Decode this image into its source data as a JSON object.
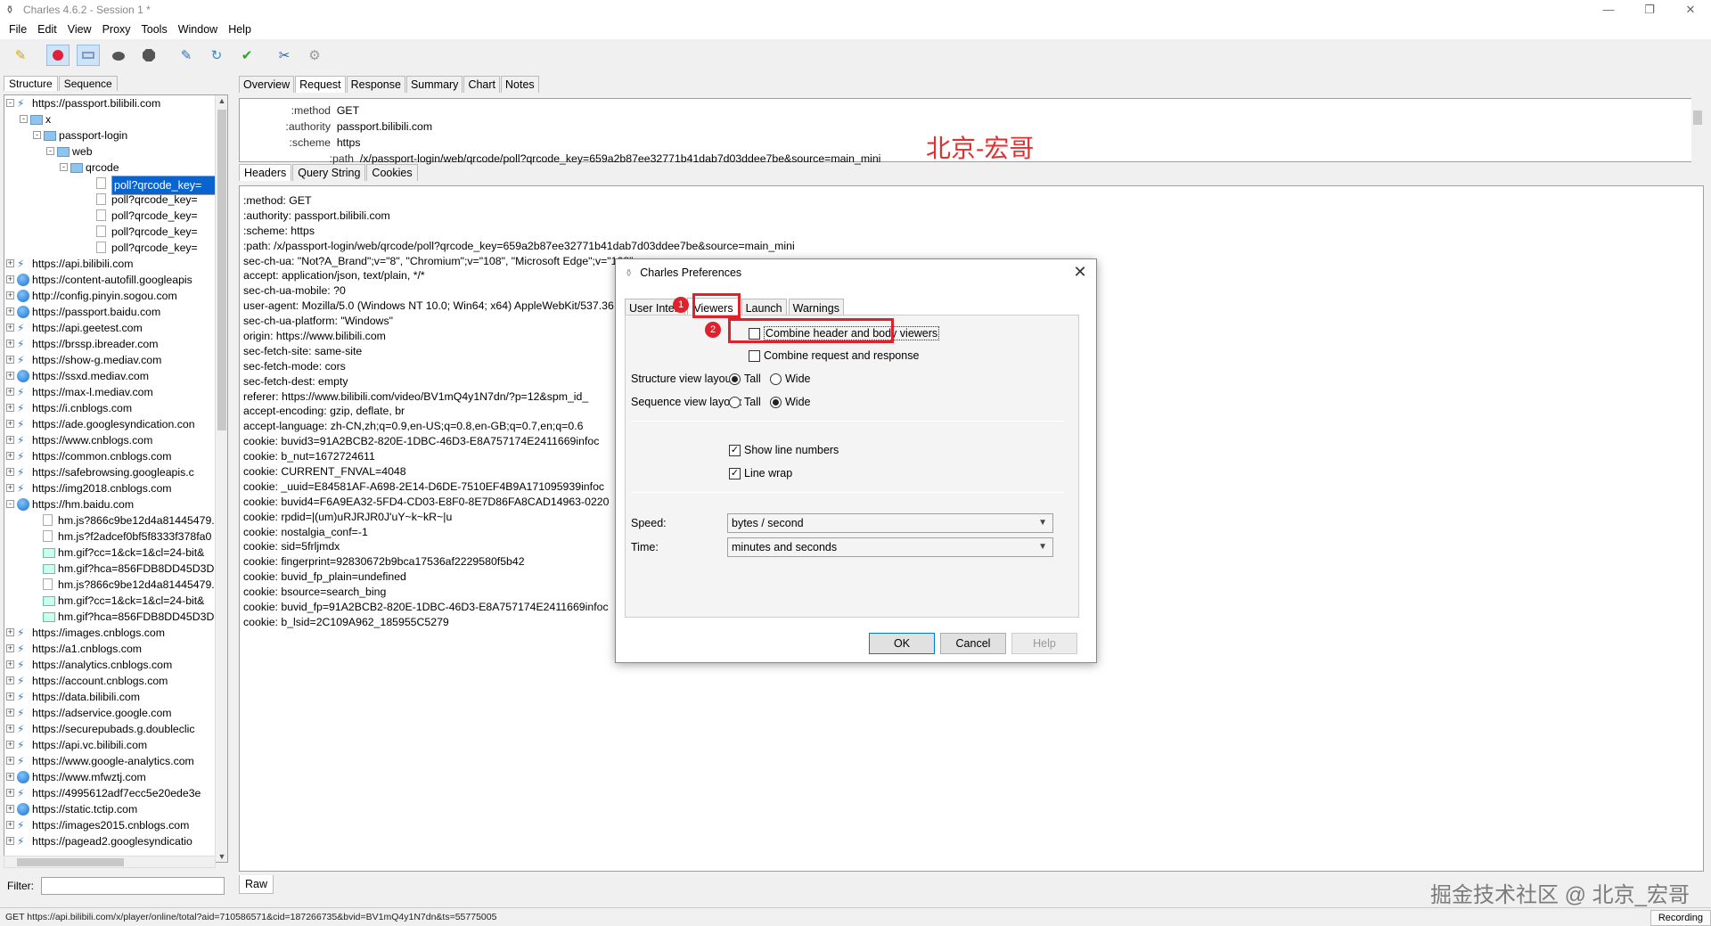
{
  "window": {
    "title": "Charles 4.6.2 - Session 1 *"
  },
  "menu": [
    "File",
    "Edit",
    "View",
    "Proxy",
    "Tools",
    "Window",
    "Help"
  ],
  "toolbar": {
    "icons": [
      "broom-icon",
      "record-icon",
      "throttle-icon",
      "turtle-icon",
      "breakpoint-icon",
      "compose-icon",
      "repeat-icon",
      "validate-icon",
      "tools-icon",
      "settings-icon"
    ]
  },
  "left": {
    "tabs": [
      "Structure",
      "Sequence"
    ],
    "tree": [
      {
        "label": "https://passport.bilibili.com",
        "indent": 0,
        "icon": "lock",
        "exp": "-"
      },
      {
        "label": "x",
        "indent": 1,
        "icon": "folder",
        "exp": "-"
      },
      {
        "label": "passport-login",
        "indent": 2,
        "icon": "folder",
        "exp": "-"
      },
      {
        "label": "web",
        "indent": 3,
        "icon": "folder",
        "exp": "-"
      },
      {
        "label": "qrcode",
        "indent": 4,
        "icon": "folder",
        "exp": "-"
      },
      {
        "label": "poll?qrcode_key=",
        "indent": 5,
        "icon": "doc",
        "exp": "",
        "selected": true
      },
      {
        "label": "poll?qrcode_key=",
        "indent": 5,
        "icon": "doc",
        "exp": ""
      },
      {
        "label": "poll?qrcode_key=",
        "indent": 5,
        "icon": "doc",
        "exp": ""
      },
      {
        "label": "poll?qrcode_key=",
        "indent": 5,
        "icon": "doc",
        "exp": ""
      },
      {
        "label": "poll?qrcode_key=",
        "indent": 5,
        "icon": "doc",
        "exp": ""
      },
      {
        "label": "https://api.bilibili.com",
        "indent": 0,
        "icon": "lock",
        "exp": "+"
      },
      {
        "label": "https://content-autofill.googleapis",
        "indent": 0,
        "icon": "globe",
        "exp": "+"
      },
      {
        "label": "http://config.pinyin.sogou.com",
        "indent": 0,
        "icon": "globe",
        "exp": "+"
      },
      {
        "label": "https://passport.baidu.com",
        "indent": 0,
        "icon": "globe",
        "exp": "+"
      },
      {
        "label": "https://api.geetest.com",
        "indent": 0,
        "icon": "lock",
        "exp": "+"
      },
      {
        "label": "https://brssp.ibreader.com",
        "indent": 0,
        "icon": "lock",
        "exp": "+"
      },
      {
        "label": "https://show-g.mediav.com",
        "indent": 0,
        "icon": "lock",
        "exp": "+"
      },
      {
        "label": "https://ssxd.mediav.com",
        "indent": 0,
        "icon": "globe",
        "exp": "+"
      },
      {
        "label": "https://max-l.mediav.com",
        "indent": 0,
        "icon": "lock",
        "exp": "+"
      },
      {
        "label": "https://i.cnblogs.com",
        "indent": 0,
        "icon": "lock",
        "exp": "+"
      },
      {
        "label": "https://ade.googlesyndication.con",
        "indent": 0,
        "icon": "lock",
        "exp": "+"
      },
      {
        "label": "https://www.cnblogs.com",
        "indent": 0,
        "icon": "lock",
        "exp": "+"
      },
      {
        "label": "https://common.cnblogs.com",
        "indent": 0,
        "icon": "lock",
        "exp": "+"
      },
      {
        "label": "https://safebrowsing.googleapis.c",
        "indent": 0,
        "icon": "lock",
        "exp": "+"
      },
      {
        "label": "https://img2018.cnblogs.com",
        "indent": 0,
        "icon": "lock",
        "exp": "+"
      },
      {
        "label": "https://hm.baidu.com",
        "indent": 0,
        "icon": "globe",
        "exp": "-"
      },
      {
        "label": "hm.js?866c9be12d4a81445479.",
        "indent": 1,
        "icon": "doc",
        "exp": ""
      },
      {
        "label": "hm.js?f2adcef0bf5f8333f378fa0",
        "indent": 1,
        "icon": "doc",
        "exp": ""
      },
      {
        "label": "hm.gif?cc=1&ck=1&cl=24-bit&",
        "indent": 1,
        "icon": "img",
        "exp": ""
      },
      {
        "label": "hm.gif?hca=856FDB8DD45D3D",
        "indent": 1,
        "icon": "img",
        "exp": ""
      },
      {
        "label": "hm.js?866c9be12d4a81445479.",
        "indent": 1,
        "icon": "doc",
        "exp": ""
      },
      {
        "label": "hm.gif?cc=1&ck=1&cl=24-bit&",
        "indent": 1,
        "icon": "img",
        "exp": ""
      },
      {
        "label": "hm.gif?hca=856FDB8DD45D3D",
        "indent": 1,
        "icon": "img",
        "exp": ""
      },
      {
        "label": "https://images.cnblogs.com",
        "indent": 0,
        "icon": "lock",
        "exp": "+"
      },
      {
        "label": "https://a1.cnblogs.com",
        "indent": 0,
        "icon": "lock",
        "exp": "+"
      },
      {
        "label": "https://analytics.cnblogs.com",
        "indent": 0,
        "icon": "lock",
        "exp": "+"
      },
      {
        "label": "https://account.cnblogs.com",
        "indent": 0,
        "icon": "lock",
        "exp": "+"
      },
      {
        "label": "https://data.bilibili.com",
        "indent": 0,
        "icon": "lock",
        "exp": "+"
      },
      {
        "label": "https://adservice.google.com",
        "indent": 0,
        "icon": "lock",
        "exp": "+"
      },
      {
        "label": "https://securepubads.g.doubleclic",
        "indent": 0,
        "icon": "lock",
        "exp": "+"
      },
      {
        "label": "https://api.vc.bilibili.com",
        "indent": 0,
        "icon": "lock",
        "exp": "+"
      },
      {
        "label": "https://www.google-analytics.com",
        "indent": 0,
        "icon": "lock",
        "exp": "+"
      },
      {
        "label": "https://www.mfwztj.com",
        "indent": 0,
        "icon": "globe",
        "exp": "+"
      },
      {
        "label": "https://4995612adf7ecc5e20ede3e",
        "indent": 0,
        "icon": "lock",
        "exp": "+"
      },
      {
        "label": "https://static.tctip.com",
        "indent": 0,
        "icon": "globe",
        "exp": "+"
      },
      {
        "label": "https://images2015.cnblogs.com",
        "indent": 0,
        "icon": "lock",
        "exp": "+"
      },
      {
        "label": "https://pagead2.googlesyndicatio",
        "indent": 0,
        "icon": "lock",
        "exp": "+"
      }
    ],
    "filter_label": "Filter:",
    "filter_value": ""
  },
  "right": {
    "tabs": [
      "Overview",
      "Request",
      "Response",
      "Summary",
      "Chart",
      "Notes"
    ],
    "active_tab": "Request",
    "summary": [
      {
        "k": ":method",
        "v": "GET"
      },
      {
        "k": ":authority",
        "v": "passport.bilibili.com"
      },
      {
        "k": ":scheme",
        "v": "https"
      },
      {
        "k": ":path",
        "v": "/x/passport-login/web/qrcode/poll?qrcode_key=659a2b87ee32771b41dab7d03ddee7be&source=main_mini"
      }
    ],
    "red_watermark": "北京-宏哥",
    "header_tabs": [
      "Headers",
      "Query String",
      "Cookies"
    ],
    "raw_lines": [
      ":method: GET",
      ":authority: passport.bilibili.com",
      ":scheme: https",
      ":path: /x/passport-login/web/qrcode/poll?qrcode_key=659a2b87ee32771b41dab7d03ddee7be&source=main_mini",
      "sec-ch-ua: \"Not?A_Brand\";v=\"8\", \"Chromium\";v=\"108\", \"Microsoft Edge\";v=\"108\"",
      "accept: application/json, text/plain, */*",
      "sec-ch-ua-mobile: ?0",
      "user-agent: Mozilla/5.0 (Windows NT 10.0; Win64; x64) AppleWebKit/537.36",
      "sec-ch-ua-platform: \"Windows\"",
      "origin: https://www.bilibili.com",
      "sec-fetch-site: same-site",
      "sec-fetch-mode: cors",
      "sec-fetch-dest: empty",
      "referer: https://www.bilibili.com/video/BV1mQ4y1N7dn/?p=12&spm_id_",
      "accept-encoding: gzip, deflate, br",
      "accept-language: zh-CN,zh;q=0.9,en-US;q=0.8,en-GB;q=0.7,en;q=0.6",
      "cookie: buvid3=91A2BCB2-820E-1DBC-46D3-E8A757174E2411669infoc",
      "cookie: b_nut=1672724611",
      "cookie: CURRENT_FNVAL=4048",
      "cookie: _uuid=E84581AF-A698-2E14-D6DE-7510EF4B9A171095939infoc",
      "cookie: buvid4=F6A9EA32-5FD4-CD03-E8F0-8E7D86FA8CAD14963-0220",
      "cookie: rpdid=|(um)uRJRJR0J'uY~k~kR~|u",
      "cookie: nostalgia_conf=-1",
      "cookie: sid=5frljmdx",
      "cookie: fingerprint=92830672b9bca17536af2229580f5b42",
      "cookie: buvid_fp_plain=undefined",
      "cookie: bsource=search_bing",
      "cookie: buvid_fp=91A2BCB2-820E-1DBC-46D3-E8A757174E2411669infoc",
      "cookie: b_lsid=2C109A962_185955C5279"
    ],
    "raw_tab": "Raw",
    "bottom_watermark": "掘金技术社区 @ 北京_宏哥"
  },
  "status": {
    "url": "GET https://api.bilibili.com/x/player/online/total?aid=710586571&cid=187266735&bvid=BV1mQ4y1N7dn&ts=55775005",
    "recording": "Recording"
  },
  "dialog": {
    "title": "Charles Preferences",
    "tabs": [
      "User Interf",
      "Viewers",
      "Launch",
      "Warnings"
    ],
    "active_tab": "Viewers",
    "combine_header_body": "Combine header and body viewers",
    "combine_req_resp": "Combine request and response",
    "structure_layout_label": "Structure view layout:",
    "sequence_layout_label": "Sequence view layout:",
    "tall": "Tall",
    "wide": "Wide",
    "show_line_numbers": "Show line numbers",
    "line_wrap": "Line wrap",
    "speed_label": "Speed:",
    "speed_value": "bytes / second",
    "time_label": "Time:",
    "time_value": "minutes and seconds",
    "ok": "OK",
    "cancel": "Cancel",
    "help": "Help",
    "badge1": "1",
    "badge2": "2"
  }
}
